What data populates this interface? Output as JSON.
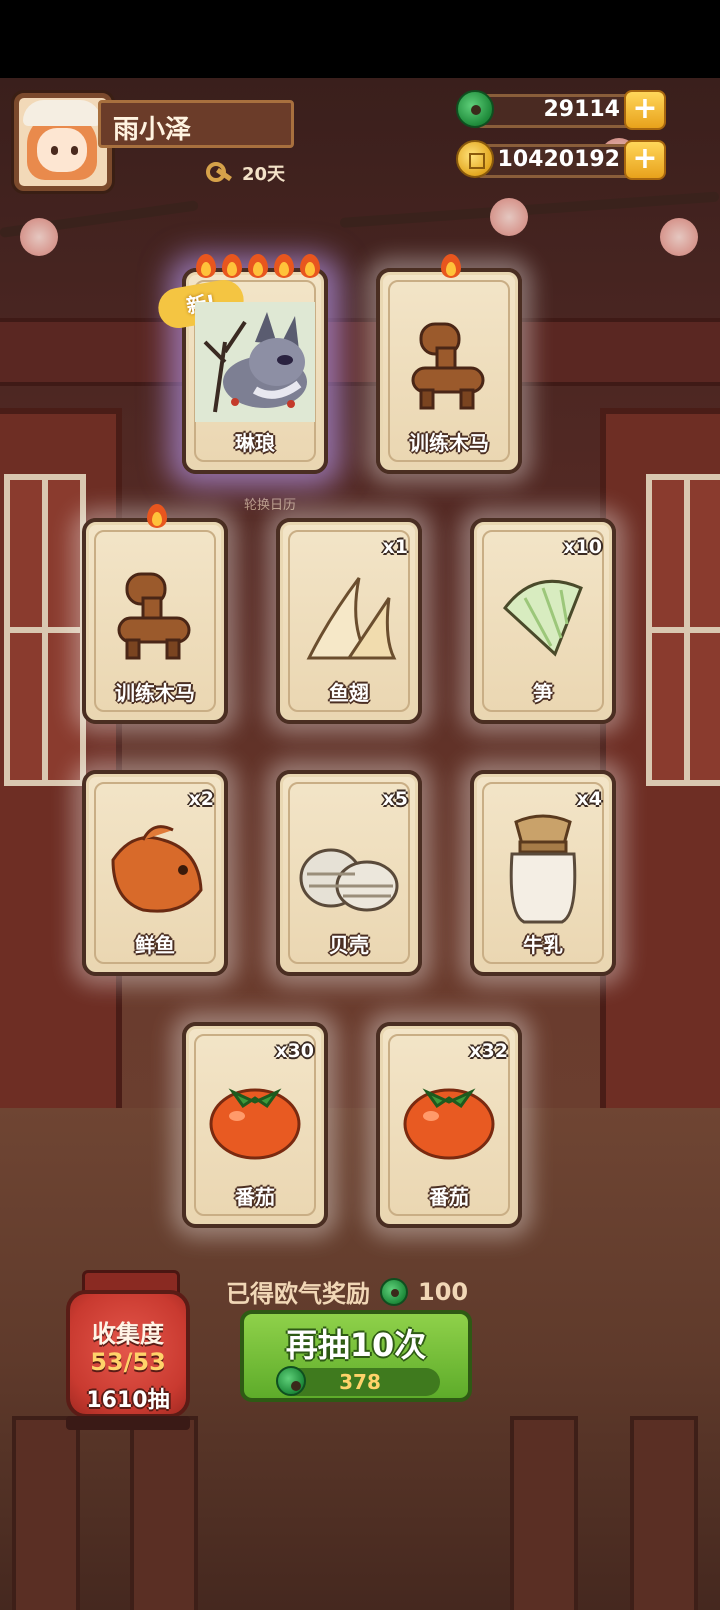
{
  "player": {
    "name": "雨小泽",
    "days": "20天"
  },
  "currencies": {
    "jade": {
      "value": "29114",
      "icon": "jade-coin-icon"
    },
    "gold": {
      "value": "10420192",
      "icon": "gold-coin-icon"
    },
    "plus_label": "+"
  },
  "background": {
    "calendar_label": "轮换日历"
  },
  "cards": [
    {
      "label": "琳琅",
      "qty": "",
      "badge": "新!",
      "flames": 5,
      "icon": "wolf-character-icon"
    },
    {
      "label": "训练木马",
      "qty": "",
      "flames": 1,
      "icon": "wooden-horse-icon"
    },
    {
      "label": "训练木马",
      "qty": "",
      "flames": 1,
      "icon": "wooden-horse-icon"
    },
    {
      "label": "鱼翅",
      "qty": "x1",
      "flames": 0,
      "icon": "shark-fin-icon"
    },
    {
      "label": "笋",
      "qty": "x10",
      "flames": 0,
      "icon": "bamboo-shoot-icon"
    },
    {
      "label": "鲜鱼",
      "qty": "x2",
      "flames": 0,
      "icon": "fish-icon"
    },
    {
      "label": "贝壳",
      "qty": "x5",
      "flames": 0,
      "icon": "shell-icon"
    },
    {
      "label": "牛乳",
      "qty": "x4",
      "flames": 0,
      "icon": "milk-jar-icon"
    },
    {
      "label": "番茄",
      "qty": "x30",
      "flames": 0,
      "icon": "tomato-icon"
    },
    {
      "label": "番茄",
      "qty": "x32",
      "flames": 0,
      "icon": "tomato-icon"
    }
  ],
  "reward": {
    "text": "已得欧气奖励",
    "amount": "100"
  },
  "redraw": {
    "label": "再抽10次",
    "cost": "378"
  },
  "collection": {
    "title": "收集度",
    "progress": "53/53",
    "draws": "1610抽"
  },
  "colors": {
    "accent_green": "#5eac2a",
    "card_bg": "#f3e5c8",
    "border_brown": "#4a2e22",
    "lantern_red": "#c93a30"
  }
}
